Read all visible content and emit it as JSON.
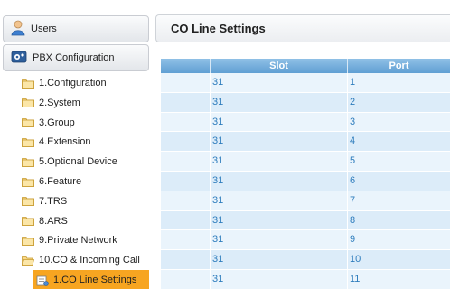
{
  "sidebar": {
    "users_label": "Users",
    "pbx_label": "PBX Configuration",
    "items": [
      {
        "label": "1.Configuration",
        "icon": "folder-icon"
      },
      {
        "label": "2.System",
        "icon": "folder-icon"
      },
      {
        "label": "3.Group",
        "icon": "folder-icon"
      },
      {
        "label": "4.Extension",
        "icon": "folder-icon"
      },
      {
        "label": "5.Optional Device",
        "icon": "folder-icon"
      },
      {
        "label": "6.Feature",
        "icon": "folder-icon"
      },
      {
        "label": "7.TRS",
        "icon": "folder-icon"
      },
      {
        "label": "8.ARS",
        "icon": "folder-icon"
      },
      {
        "label": "9.Private Network",
        "icon": "folder-icon"
      },
      {
        "label": "10.CO & Incoming Call",
        "icon": "folder-open-icon"
      }
    ],
    "sub_item": {
      "label": "1.CO Line Settings",
      "icon": "settings-page-icon"
    }
  },
  "main": {
    "title": "CO Line Settings",
    "columns": [
      "Slot",
      "Port"
    ],
    "rows": [
      {
        "slot": "31",
        "port": "1"
      },
      {
        "slot": "31",
        "port": "2"
      },
      {
        "slot": "31",
        "port": "3"
      },
      {
        "slot": "31",
        "port": "4"
      },
      {
        "slot": "31",
        "port": "5"
      },
      {
        "slot": "31",
        "port": "6"
      },
      {
        "slot": "31",
        "port": "7"
      },
      {
        "slot": "31",
        "port": "8"
      },
      {
        "slot": "31",
        "port": "9"
      },
      {
        "slot": "31",
        "port": "10"
      },
      {
        "slot": "31",
        "port": "11"
      }
    ]
  },
  "colors": {
    "selected": "#f7a521",
    "header_blue": "#6aa6d8",
    "link_blue": "#2f7dbd"
  }
}
